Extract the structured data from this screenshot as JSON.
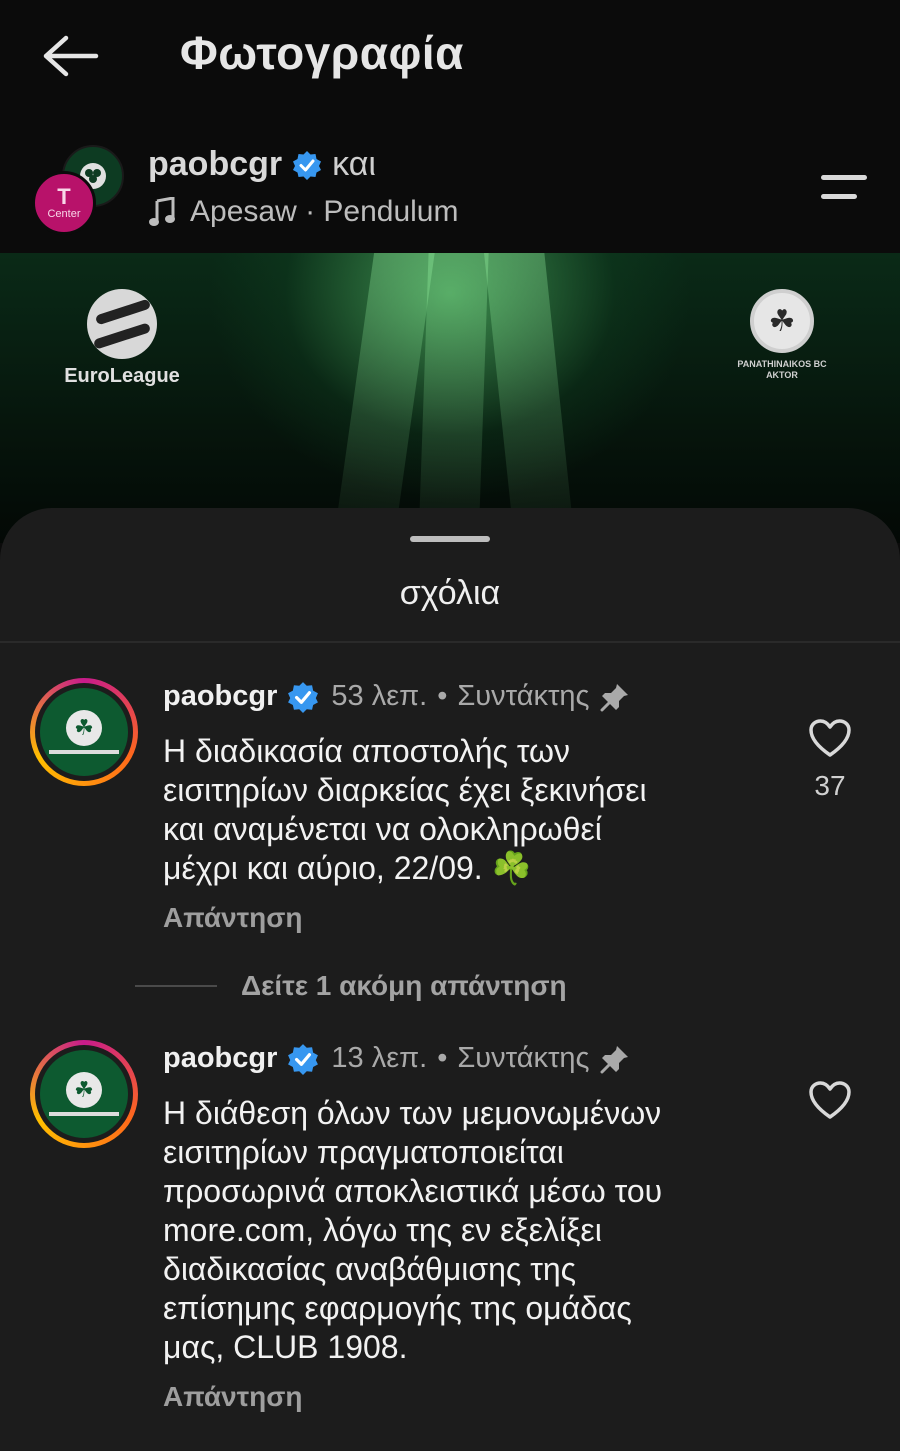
{
  "topbar": {
    "back_icon": "arrow-left-icon",
    "title": "Φωτογραφία"
  },
  "post_header": {
    "avatar_front_label_top": "T",
    "avatar_front_label_bottom": "Center",
    "username": "paobcgr",
    "and_text": "και",
    "music_icon": "music-note-icon",
    "music_text": "Apesaw · Pendulum",
    "menu_icon": "menu-icon"
  },
  "banner": {
    "left_logo_text": "EuroLeague",
    "right_logo_text_line1": "PANATHINAIKOS BC",
    "right_logo_text_line2": "AKTOR"
  },
  "comments_sheet": {
    "title": "σχόλια",
    "comments": [
      {
        "username": "paobcgr",
        "time": "53 λεπ.",
        "separator": "•",
        "role": "Συντάκτης",
        "text": "Η διαδικασία αποστολής των\nεισιτηρίων διαρκείας έχει ξεκινήσει\nκαι αναμένεται να ολοκληρωθεί\nμέχρι και αύριο, 22/09. ☘️",
        "reply_label": "Απάντηση",
        "likes": "37"
      },
      {
        "username": "paobcgr",
        "time": "13 λεπ.",
        "separator": "•",
        "role": "Συντάκτης",
        "text": "Η διάθεση όλων των μεμονωμένων\nεισιτηρίων πραγματοποιείται\nπροσωρινά αποκλειστικά μέσω του\nmore.com, λόγω της εν εξελίξει\nδιαδικασίας αναβάθμισης της\nεπίσημης εφαρμογής της ομάδας\nμας, CLUB 1908.",
        "reply_label": "Απάντηση",
        "likes": ""
      }
    ],
    "more_replies": "Δείτε 1 ακόμη απάντηση"
  },
  "colors": {
    "background": "#0b0b0b",
    "sheet": "#1c1c1c",
    "verified_blue": "#3797f0",
    "banner_green": "#0a2a17"
  }
}
